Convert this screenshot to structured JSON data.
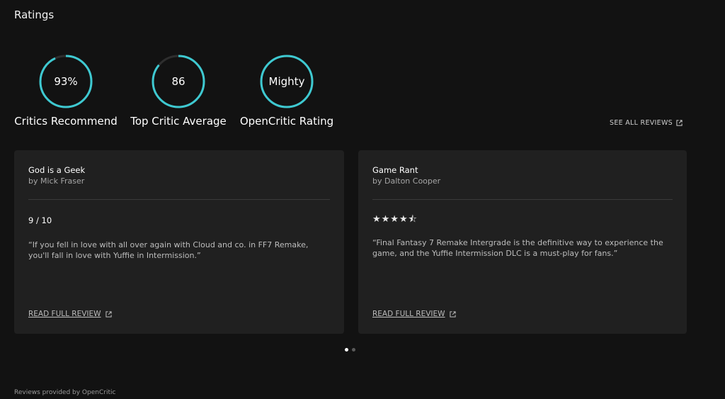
{
  "section_title": "Ratings",
  "accent_color": "#3ec9d1",
  "metrics": [
    {
      "value": "93%",
      "label": "Critics Recommend",
      "fraction": 0.93
    },
    {
      "value": "86",
      "label": "Top Critic Average",
      "fraction": 0.86
    },
    {
      "value": "Mighty",
      "label": "OpenCritic Rating",
      "fraction": 1.0
    }
  ],
  "see_all": {
    "label": "SEE ALL REVIEWS",
    "icon": "external-link-icon"
  },
  "reviews": [
    {
      "outlet": "God is a Geek",
      "author": "by Mick Fraser",
      "score": "9 / 10",
      "quote": "“If you fell in love with all over again with Cloud and co. in FF7 Remake, you'll fall in love with Yuffie in Intermission.”",
      "read_label": "READ FULL REVIEW"
    },
    {
      "outlet": "Game Rant",
      "author": "by Dalton Cooper",
      "stars": 4.5,
      "stars_text": "★★★★⯪",
      "quote": "“Final Fantasy 7 Remake Intergrade is the definitive way to experience the game, and the Yuffie Intermission DLC is a must-play for fans.”",
      "read_label": "READ FULL REVIEW"
    }
  ],
  "pagination": {
    "current": 1,
    "total": 2
  },
  "footer": "Reviews provided by OpenCritic"
}
